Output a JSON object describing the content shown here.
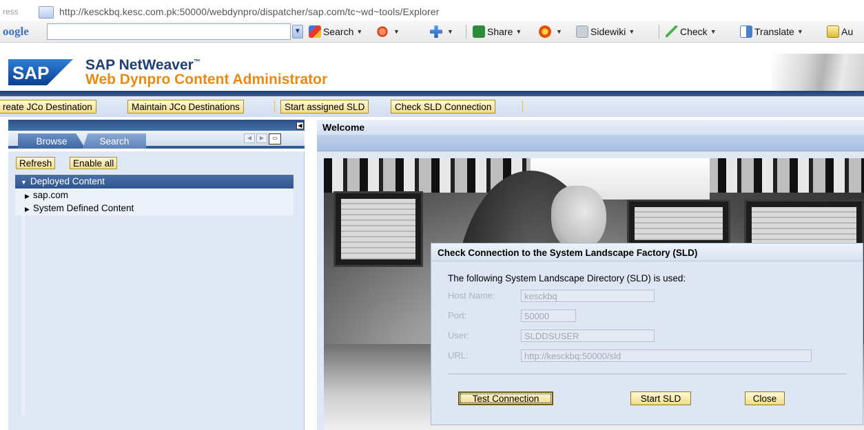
{
  "browser": {
    "address_prefix": "ress",
    "url": "http://kesckbq.kesc.com.pk:50000/webdynpro/dispatcher/sap.com/tc~wd~tools/Explorer"
  },
  "google_toolbar": {
    "logo_text": "oogle",
    "search_value": "",
    "items": [
      {
        "label": "Search",
        "icon": "google-search-icon"
      },
      {
        "label": "",
        "icon": "bookmark-star-icon"
      },
      {
        "label": "",
        "icon": "plus-icon"
      },
      {
        "label": "Share",
        "icon": "share-icon"
      },
      {
        "label": "",
        "icon": "notification-icon"
      },
      {
        "label": "Sidewiki",
        "icon": "sidewiki-icon"
      },
      {
        "label": "Check",
        "icon": "spellcheck-icon"
      },
      {
        "label": "Translate",
        "icon": "translate-icon"
      },
      {
        "label": "Au",
        "icon": "autofill-icon"
      }
    ]
  },
  "header": {
    "brand": "SAP",
    "title_line1": "SAP NetWeaver",
    "trademark": "™",
    "title_line2": "Web Dynpro Content Administrator"
  },
  "link_bar": {
    "buttons": [
      "reate JCo Destination",
      "Maintain JCo Destinations",
      "Start assigned SLD",
      "Check SLD Connection"
    ]
  },
  "left_panel": {
    "tabs": [
      "Browse",
      "Search"
    ],
    "active_tab": "Browse",
    "buttons": [
      "Refresh",
      "Enable all"
    ],
    "tree": {
      "root": "Deployed Content",
      "children": [
        "sap.com",
        "System Defined Content"
      ]
    }
  },
  "right_panel": {
    "title": "Welcome"
  },
  "dialog": {
    "title": "Check Connection to the System Landscape Factory (SLD)",
    "intro": "The following System Landscape Directory (SLD) is used:",
    "fields": [
      {
        "label": "Host Name:",
        "value": "kesckbq"
      },
      {
        "label": "Port:",
        "value": "50000"
      },
      {
        "label": "User:",
        "value": "SLDDSUSER"
      },
      {
        "label": "URL:",
        "value": "http://kesckbq:50000/sld"
      }
    ],
    "buttons": {
      "test": "Test Connection",
      "start": "Start SLD",
      "close": "Close"
    }
  },
  "colors": {
    "sap_blue": "#1f3f73",
    "sap_orange": "#e88a12",
    "button_yellow": "#f1dc8a",
    "panel_bg": "#dfe8f4"
  }
}
